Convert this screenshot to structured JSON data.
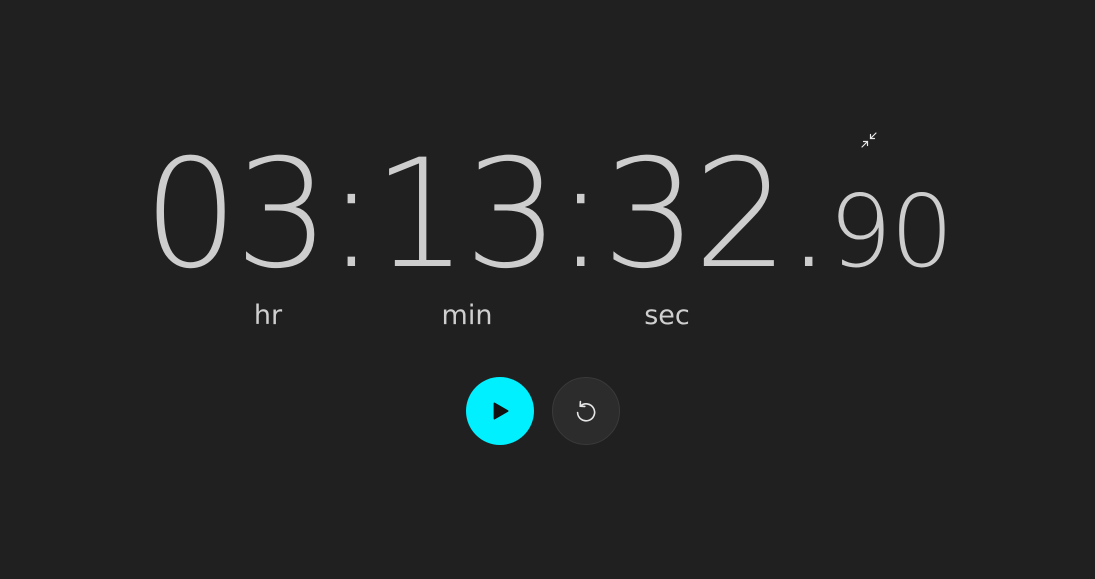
{
  "window": {
    "background": "#202020"
  },
  "timer": {
    "hours": "03",
    "minutes": "13",
    "seconds": "32",
    "hundredths": "90",
    "separator": ":",
    "decimal": "."
  },
  "units": {
    "hr": "hr",
    "min": "min",
    "sec": "sec"
  },
  "controls": {
    "play_icon": "play-icon",
    "reset_icon": "reset-icon",
    "compact_icon": "compact-overlay-icon",
    "accent": "#00f0ff"
  }
}
